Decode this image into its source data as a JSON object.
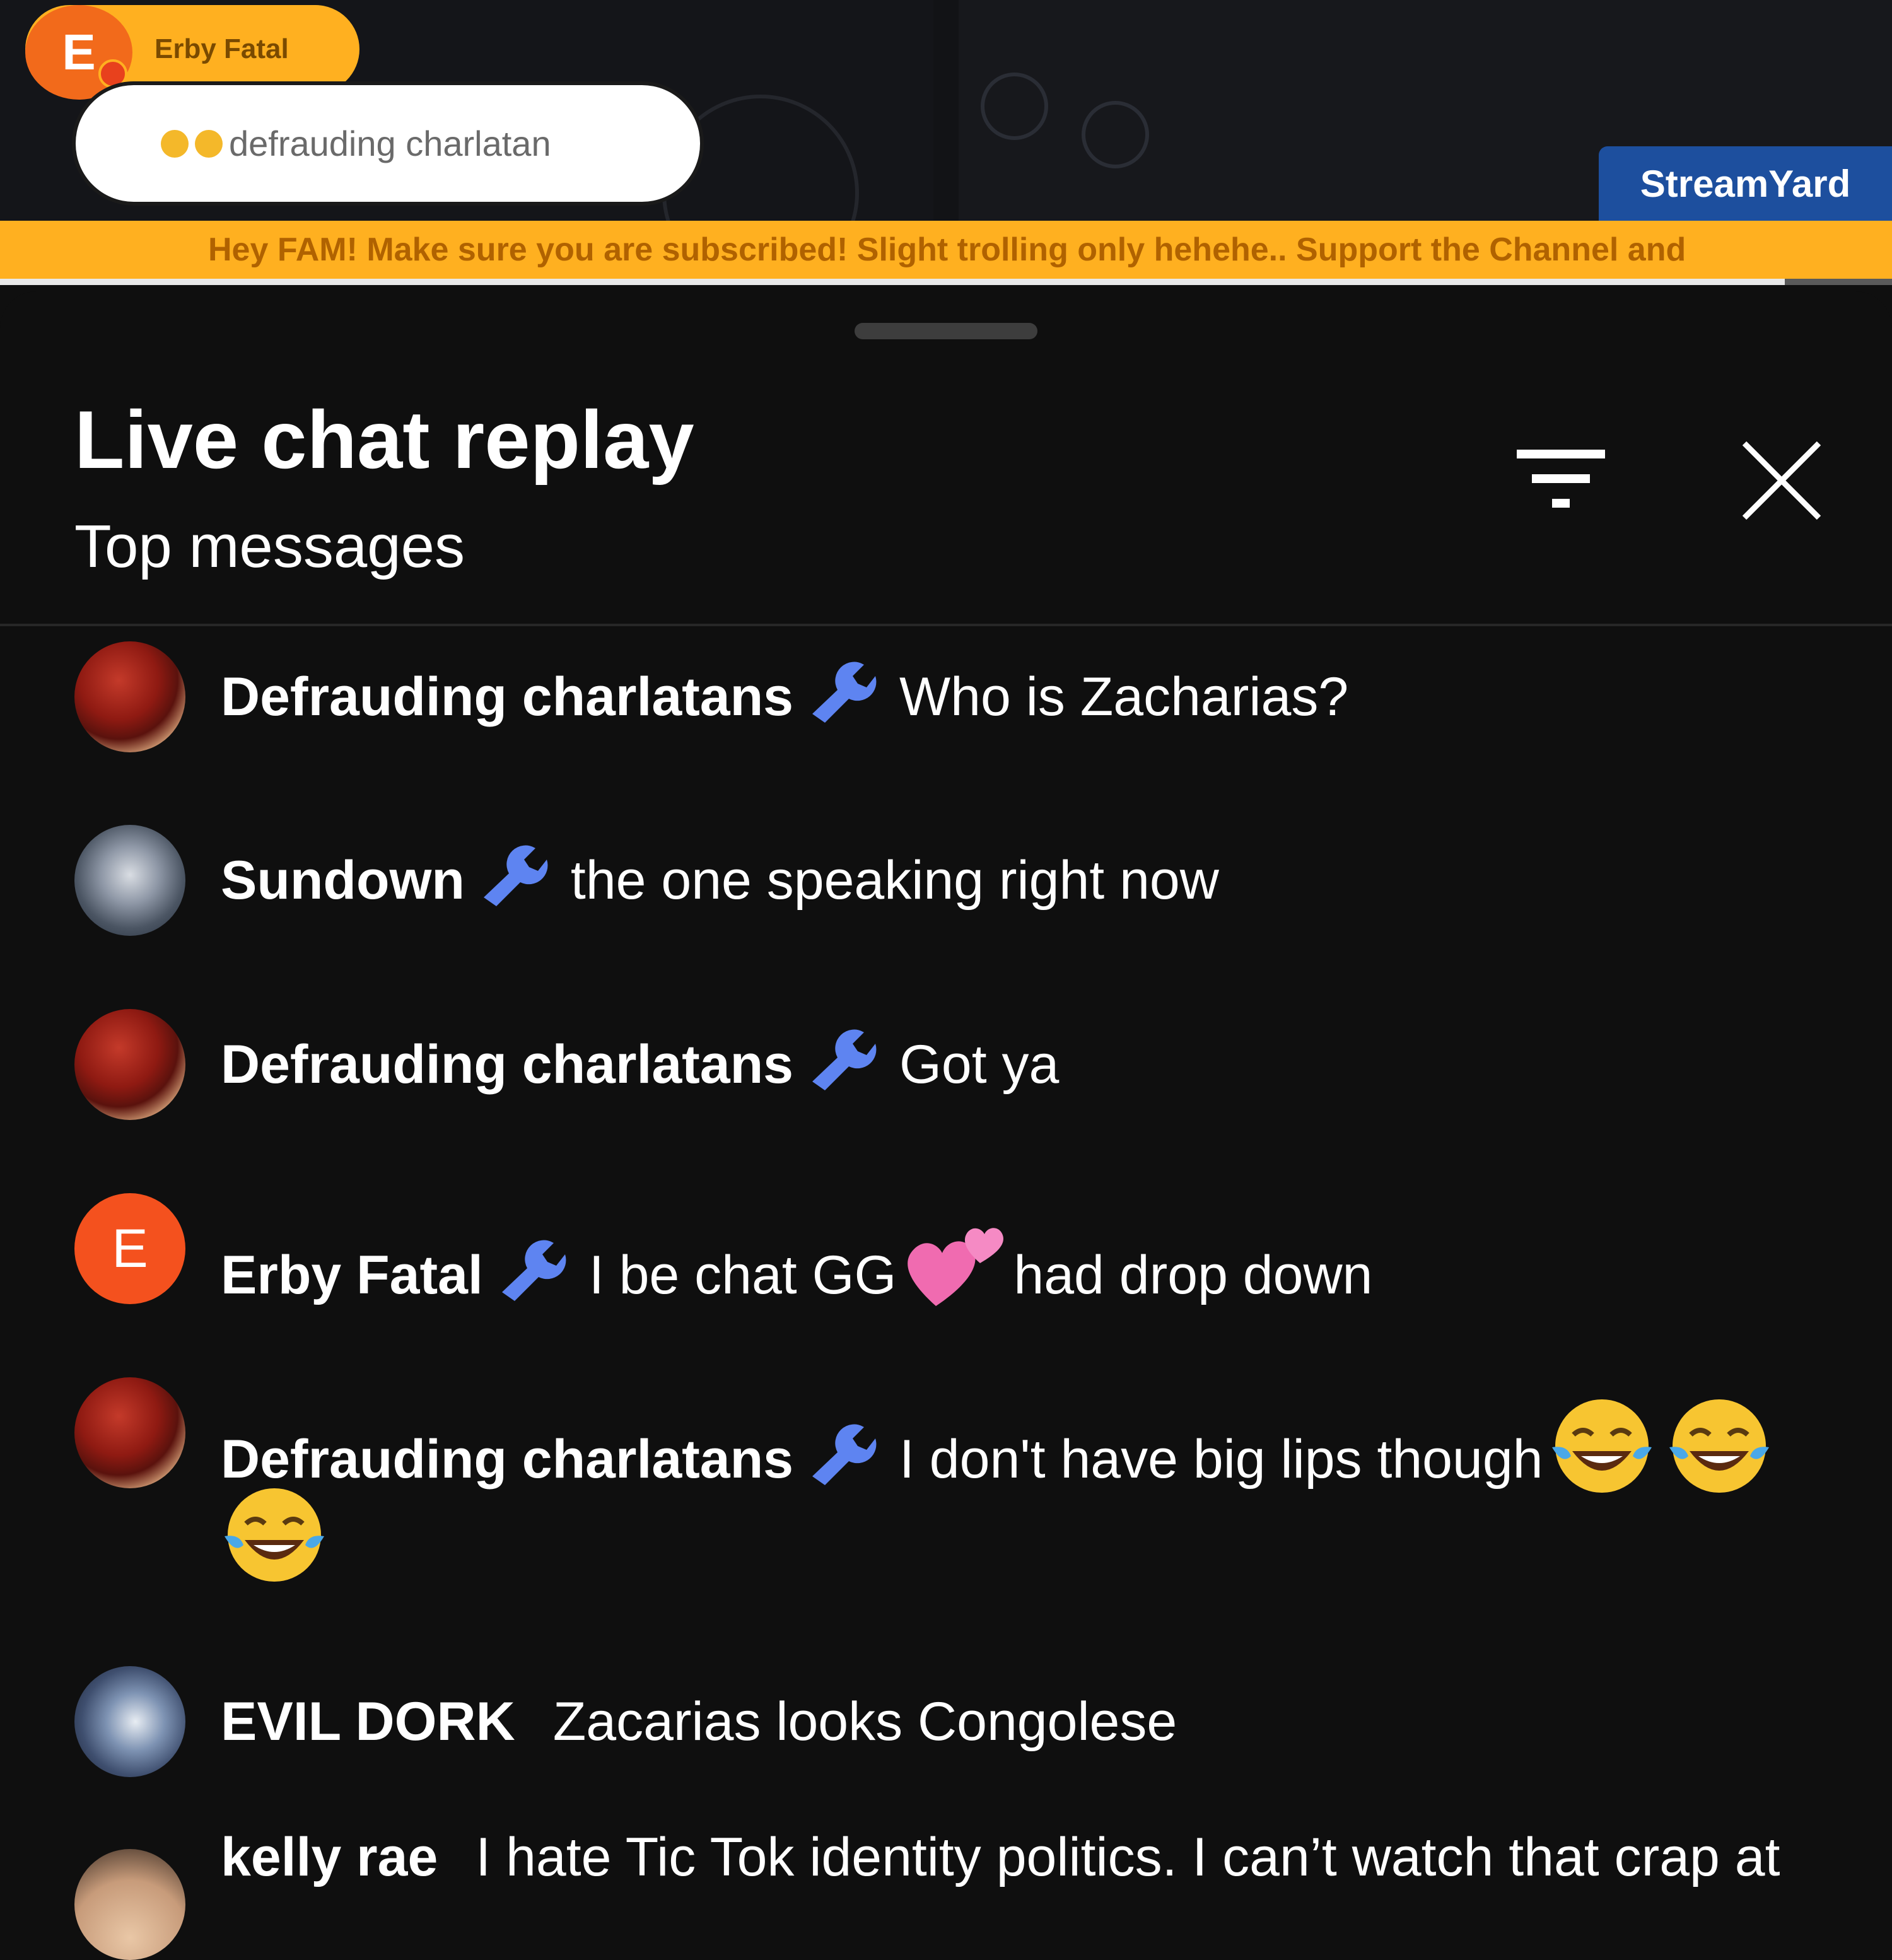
{
  "video": {
    "top_pill_name": "Erby Fatal",
    "top_pill_initial": "E",
    "bubble_text": "defrauding charlatan",
    "watermark": "StreamYard",
    "ticker_text": "Hey FAM! Make sure you are subscribed! Slight trolling only hehehe.. Support the Channel and"
  },
  "panel": {
    "title": "Live chat replay",
    "subtitle": "Top messages",
    "filter_icon": "filter-icon",
    "close_icon": "close-icon"
  },
  "messages": [
    {
      "author": "Defrauding charlatans",
      "moderator": true,
      "avatar": "photo-red",
      "text": "Who is Zacharias?"
    },
    {
      "author": "Sundown",
      "moderator": true,
      "avatar": "photo-gray",
      "text": "the one speaking right now"
    },
    {
      "author": "Defrauding charlatans",
      "moderator": true,
      "avatar": "photo-red",
      "text": "Got ya"
    },
    {
      "author": "Erby Fatal",
      "moderator": true,
      "avatar": "letter",
      "initial": "E",
      "text_before": "I be chat GG",
      "emoji": "two-hearts-emoji",
      "text_after": "had drop down"
    },
    {
      "author": "Defrauding charlatans",
      "moderator": true,
      "avatar": "photo-red",
      "text": "I don't have big lips though",
      "emojis": [
        "tears-of-joy-emoji",
        "tears-of-joy-emoji",
        "tears-of-joy-emoji"
      ]
    },
    {
      "author": "EVIL DORK",
      "moderator": false,
      "avatar": "photo-blue",
      "text": "Zacarias looks Congolese"
    },
    {
      "author": "kelly rae",
      "moderator": false,
      "avatar": "photo-skin",
      "text": "I hate Tic Tok identity politics. I can’t watch that crap at"
    }
  ],
  "colors": {
    "background": "#0f0f0f",
    "accent_yellow": "#ffb020",
    "wrench_blue": "#5e84f1",
    "avatar_orange": "#f4511e",
    "streamyard_blue": "#1d4f9e"
  }
}
